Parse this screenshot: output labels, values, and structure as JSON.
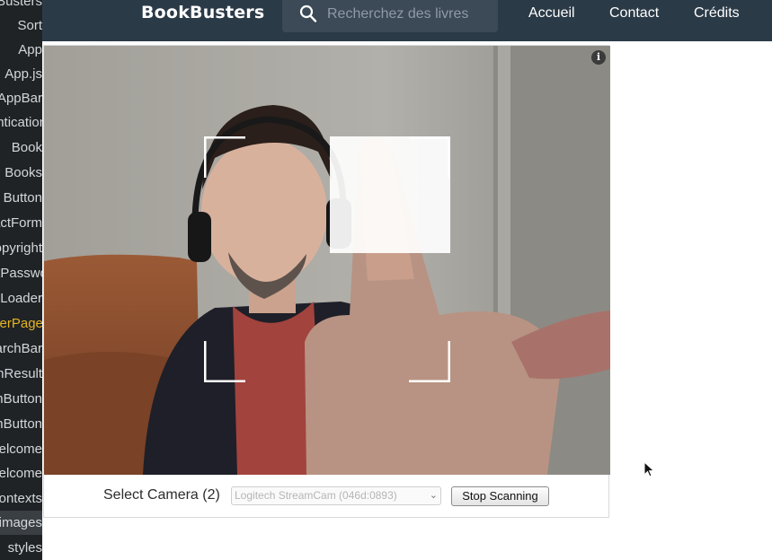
{
  "sidebar": {
    "items": [
      {
        "label": "BookBusters",
        "active": false,
        "selected": false
      },
      {
        "label": "Sort",
        "active": false,
        "selected": false
      },
      {
        "label": "App",
        "active": false,
        "selected": false
      },
      {
        "label": "App.js",
        "active": false,
        "selected": false
      },
      {
        "label": "AppBar",
        "active": false,
        "selected": false
      },
      {
        "label": "Authentication",
        "active": false,
        "selected": false
      },
      {
        "label": "Book",
        "active": false,
        "selected": false
      },
      {
        "label": "Books",
        "active": false,
        "selected": false
      },
      {
        "label": "Button",
        "active": false,
        "selected": false
      },
      {
        "label": "ContactForm",
        "active": false,
        "selected": false
      },
      {
        "label": "Copyright",
        "active": false,
        "selected": false
      },
      {
        "label": "ForgotPassword",
        "active": false,
        "selected": false
      },
      {
        "label": "Loader",
        "active": false,
        "selected": false
      },
      {
        "label": "ScannerPage",
        "active": true,
        "selected": false
      },
      {
        "label": "SearchBar",
        "active": false,
        "selected": false
      },
      {
        "label": "SearchResults",
        "active": false,
        "selected": false
      },
      {
        "label": "SignInButton",
        "active": false,
        "selected": false
      },
      {
        "label": "SignButton",
        "active": false,
        "selected": false
      },
      {
        "label": "Welcome",
        "active": false,
        "selected": false
      },
      {
        "label": "Welcome",
        "active": false,
        "selected": false
      },
      {
        "label": "contexts",
        "active": false,
        "selected": false
      },
      {
        "label": "images",
        "active": false,
        "selected": true
      },
      {
        "label": "styles",
        "active": false,
        "selected": false
      }
    ]
  },
  "navbar": {
    "brand": "BookBusters",
    "search_placeholder": "Recherchez des livres",
    "links": [
      "Accueil",
      "Contact",
      "Crédits"
    ]
  },
  "scanner": {
    "info_icon_label": "i",
    "select_camera_label": "Select Camera (2)",
    "camera_option": "Logitech StreamCam (046d:0893)",
    "stop_button": "Stop Scanning"
  },
  "colors": {
    "navbar_bg": "#2b3a47",
    "sidebar_bg": "#1f2326",
    "active_file": "#e6b422"
  },
  "icons": [
    "search-icon",
    "info-icon",
    "chevron-down-icon",
    "mouse-cursor-icon"
  ]
}
